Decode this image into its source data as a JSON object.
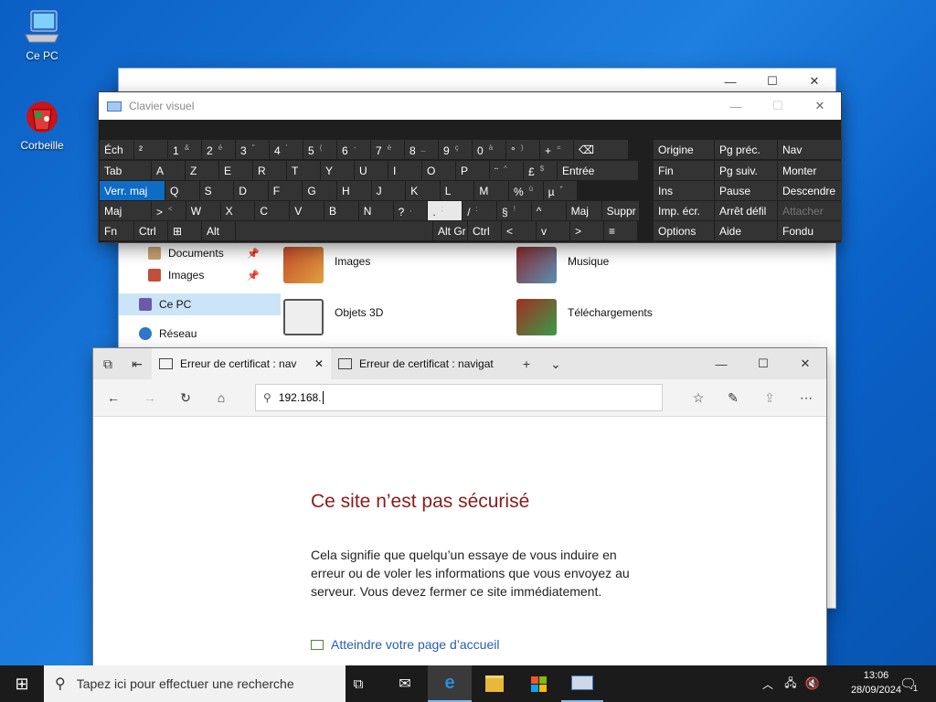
{
  "desktop": {
    "icons": [
      {
        "label": "Ce PC",
        "icon": "computer-icon"
      },
      {
        "label": "Corbeille",
        "icon": "recycle-bin-icon"
      }
    ]
  },
  "explorer": {
    "nav": [
      {
        "label": "Documents",
        "pinned": true
      },
      {
        "label": "Images",
        "pinned": true
      },
      {
        "label": "Ce PC",
        "selected": true
      },
      {
        "label": "Réseau"
      }
    ],
    "folders": [
      {
        "label": "Images"
      },
      {
        "label": "Musique"
      },
      {
        "label": "Objets 3D"
      },
      {
        "label": "Téléchargements"
      }
    ]
  },
  "osk": {
    "title": "Clavier visuel",
    "row1": [
      "Éch",
      "²",
      "1",
      "2",
      "3",
      "4",
      "5",
      "6",
      "7",
      "8",
      "9",
      "0",
      "°",
      "+",
      "⌫"
    ],
    "row1_sub": [
      "",
      "",
      "&",
      "é",
      "\"",
      "'",
      "(",
      "-",
      "è",
      "_",
      "ç",
      "à",
      ")",
      "=",
      ""
    ],
    "row2": [
      "Tab",
      "A",
      "Z",
      "E",
      "R",
      "T",
      "Y",
      "U",
      "I",
      "O",
      "P",
      "¨",
      "£",
      "Entrée"
    ],
    "row2_sub": [
      "",
      "",
      "",
      "",
      "",
      "",
      "",
      "",
      "",
      "",
      "",
      "^",
      "$",
      ""
    ],
    "row3": [
      "Verr. maj",
      "Q",
      "S",
      "D",
      "F",
      "G",
      "H",
      "J",
      "K",
      "L",
      "M",
      "%",
      "µ"
    ],
    "row3_sub": [
      "",
      "",
      "",
      "",
      "",
      "",
      "",
      "",
      "",
      "",
      "",
      "ù",
      "*"
    ],
    "row4": [
      "Maj",
      ">",
      "W",
      "X",
      "C",
      "V",
      "B",
      "N",
      "?",
      ".",
      "/",
      "§",
      "^",
      "Maj",
      "Suppr"
    ],
    "row4_sub": [
      "",
      "<",
      "",
      "",
      "",
      "",
      "",
      "",
      ",",
      ";",
      ":",
      "!",
      "",
      ""
    ],
    "row5": [
      "Fn",
      "Ctrl",
      "⊞",
      "Alt",
      "",
      "Alt Gr",
      "Ctrl",
      "<",
      "v",
      ">",
      "≡"
    ],
    "side": [
      [
        "Origine",
        "Pg préc.",
        "Nav"
      ],
      [
        "Fin",
        "Pg suiv.",
        "Monter"
      ],
      [
        "Ins",
        "Pause",
        "Descendre"
      ],
      [
        "Imp. écr.",
        "Arrêt défil",
        "Attacher"
      ],
      [
        "Options",
        "Aide",
        "Fondu"
      ]
    ]
  },
  "edge": {
    "tabs": [
      {
        "title": "Erreur de certificat : nav",
        "active": true
      },
      {
        "title": "Erreur de certificat : navigat",
        "active": false
      }
    ],
    "url": "192.168.",
    "error_title": "Ce site n’est pas sécurisé",
    "error_body": "Cela signifie que quelqu’un essaye de vous induire en erreur ou de voler les informations que vous envoyez au serveur. Vous devez fermer ce site immédiatement.",
    "home_link": "Atteindre votre page d’accueil"
  },
  "taskbar": {
    "search_placeholder": "Tapez ici pour effectuer une recherche",
    "time": "13:06",
    "date": "28/09/2024",
    "notification_count": "1"
  }
}
